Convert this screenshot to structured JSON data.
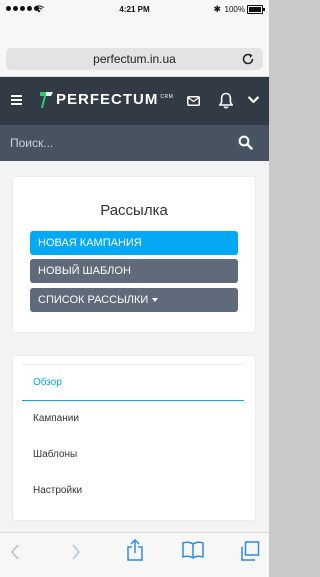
{
  "status_bar": {
    "time": "4:21 PM",
    "battery": "100%"
  },
  "browser": {
    "url": "perfectum.in.ua"
  },
  "app": {
    "logo_text": "PERFECTUM",
    "logo_suffix": "CRM",
    "search_placeholder": "Поиск..."
  },
  "mailing_panel": {
    "title": "Рассылка",
    "new_campaign": "НОВАЯ КАМПАНИЯ",
    "new_template": "НОВЫЙ ШАБЛОН",
    "mailing_list": "СПИСОК РАССЫЛКИ"
  },
  "nav": {
    "items": [
      {
        "label": "Обзор"
      },
      {
        "label": "Кампании"
      },
      {
        "label": "Шаблоны"
      },
      {
        "label": "Настройки"
      }
    ]
  },
  "colors": {
    "appbar": "#323a45",
    "searchbar": "#475361",
    "primary": "#03a9f4",
    "secondary_button": "#5f6a7a",
    "logo_green": "#2ecc71"
  },
  "icons": [
    "hamburger-icon",
    "mail-icon",
    "bell-icon",
    "chevron-down-icon",
    "search-icon",
    "reload-icon",
    "back-icon",
    "forward-icon",
    "share-icon",
    "bookmarks-icon",
    "tabs-icon"
  ]
}
